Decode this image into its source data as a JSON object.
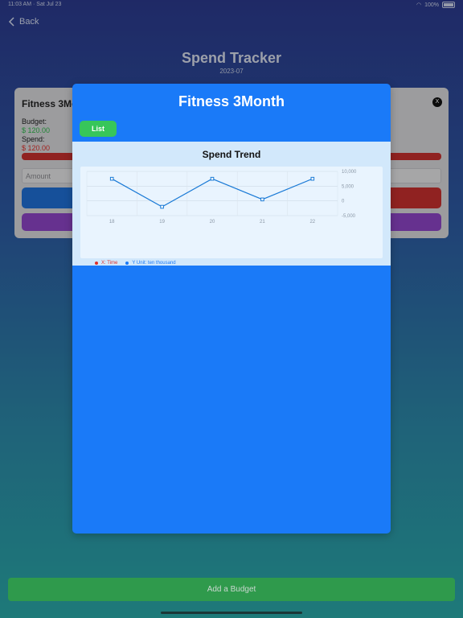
{
  "status_bar": {
    "time": "11:03 AM · Sat Jul 23",
    "battery": "100%"
  },
  "nav": {
    "back_label": "Back"
  },
  "header": {
    "title": "Spend Tracker",
    "subtitle": "2023-07"
  },
  "background_card": {
    "name": "Fitness 3Mo",
    "budget_label": "Budget:",
    "budget_value": "$ 120.00",
    "spend_label": "Spend:",
    "spend_value": "$ 120.00",
    "close_label": "X",
    "amount_placeholder": "Amount",
    "colors": {
      "budget": "#2db84a",
      "spend": "#e0302a"
    }
  },
  "modal": {
    "title": "Fitness 3Month",
    "list_button": "List",
    "chart_title": "Spend Trend",
    "legend": {
      "x_label": "X: Time",
      "y_label": "Y Unit: ten thousand",
      "x_color": "#e0302a",
      "y_color": "#1a7af8"
    }
  },
  "chart_data": {
    "type": "line",
    "x": [
      "18",
      "19",
      "20",
      "21",
      "22"
    ],
    "series": [
      {
        "values": [
          7500,
          -2000,
          7500,
          500,
          7500
        ]
      }
    ],
    "y_ticks": [
      "10,000",
      "5,000",
      "0",
      "-5,000"
    ],
    "ylim": [
      -5000,
      10000
    ],
    "grid": true,
    "line_color": "#1a7ad6"
  },
  "footer": {
    "add_budget_label": "Add a Budget"
  }
}
